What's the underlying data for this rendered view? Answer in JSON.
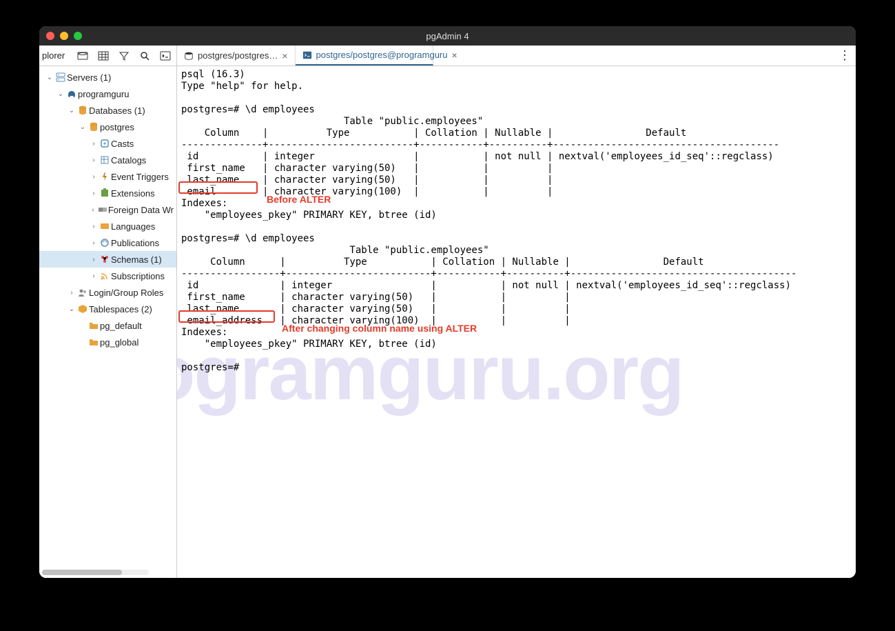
{
  "window": {
    "title": "pgAdmin 4"
  },
  "sidebar": {
    "header": "plorer",
    "items": [
      {
        "label": "Servers (1)",
        "indent": 1,
        "arrow": "v",
        "icon": "server"
      },
      {
        "label": "programguru",
        "indent": 2,
        "arrow": "v",
        "icon": "elephant"
      },
      {
        "label": "Databases (1)",
        "indent": 3,
        "arrow": "v",
        "icon": "db-stack"
      },
      {
        "label": "postgres",
        "indent": 4,
        "arrow": "v",
        "icon": "db-stack"
      },
      {
        "label": "Casts",
        "indent": 5,
        "arrow": ">",
        "icon": "cast"
      },
      {
        "label": "Catalogs",
        "indent": 5,
        "arrow": ">",
        "icon": "catalog"
      },
      {
        "label": "Event Triggers",
        "indent": 5,
        "arrow": ">",
        "icon": "trigger"
      },
      {
        "label": "Extensions",
        "indent": 5,
        "arrow": ">",
        "icon": "extension"
      },
      {
        "label": "Foreign Data Wr",
        "indent": 5,
        "arrow": ">",
        "icon": "fdw"
      },
      {
        "label": "Languages",
        "indent": 5,
        "arrow": ">",
        "icon": "lang"
      },
      {
        "label": "Publications",
        "indent": 5,
        "arrow": ">",
        "icon": "pub"
      },
      {
        "label": "Schemas (1)",
        "indent": 5,
        "arrow": ">",
        "icon": "schema",
        "selected": true
      },
      {
        "label": "Subscriptions",
        "indent": 5,
        "arrow": ">",
        "icon": "sub"
      },
      {
        "label": "Login/Group Roles",
        "indent": 3,
        "arrow": ">",
        "icon": "roles"
      },
      {
        "label": "Tablespaces (2)",
        "indent": 3,
        "arrow": "v",
        "icon": "tablespace"
      },
      {
        "label": "pg_default",
        "indent": 4,
        "arrow": "",
        "icon": "folder"
      },
      {
        "label": "pg_global",
        "indent": 4,
        "arrow": "",
        "icon": "folder"
      }
    ]
  },
  "tabs": [
    {
      "label": "postgres/postgres…",
      "icon": "db",
      "active": false
    },
    {
      "label": "postgres/postgres@programguru",
      "icon": "psql",
      "active": true
    }
  ],
  "psql": {
    "version_line": "psql (16.3)",
    "help_line": "Type \"help\" for help.",
    "prompt": "postgres=#",
    "cmd": "\\d employees",
    "table1": {
      "title": "Table \"public.employees\"",
      "header": "    Column    |          Type           | Collation | Nullable |                Default                ",
      "sep": "--------------+-------------------------+-----------+----------+---------------------------------------",
      "rows": [
        " id           | integer                 |           | not null | nextval('employees_id_seq'::regclass)",
        " first_name   | character varying(50)   |           |          | ",
        " last_name    | character varying(50)   |           |          | ",
        " email        | character varying(100)  |           |          | "
      ],
      "idx_header": "Indexes:",
      "idx_line": "    \"employees_pkey\" PRIMARY KEY, btree (id)"
    },
    "table2": {
      "title": "Table \"public.employees\"",
      "header": "     Column      |          Type           | Collation | Nullable |                Default                ",
      "sep": "-----------------+-------------------------+-----------+----------+---------------------------------------",
      "rows": [
        " id              | integer                 |           | not null | nextval('employees_id_seq'::regclass)",
        " first_name      | character varying(50)   |           |          | ",
        " last_name       | character varying(50)   |           |          | ",
        " email_address   | character varying(100)  |           |          | "
      ],
      "idx_header": "Indexes:",
      "idx_line": "    \"employees_pkey\" PRIMARY KEY, btree (id)"
    }
  },
  "annotations": {
    "before": "Before ALTER",
    "after": "After changing column name using ALTER"
  },
  "watermark": "programguru.org"
}
